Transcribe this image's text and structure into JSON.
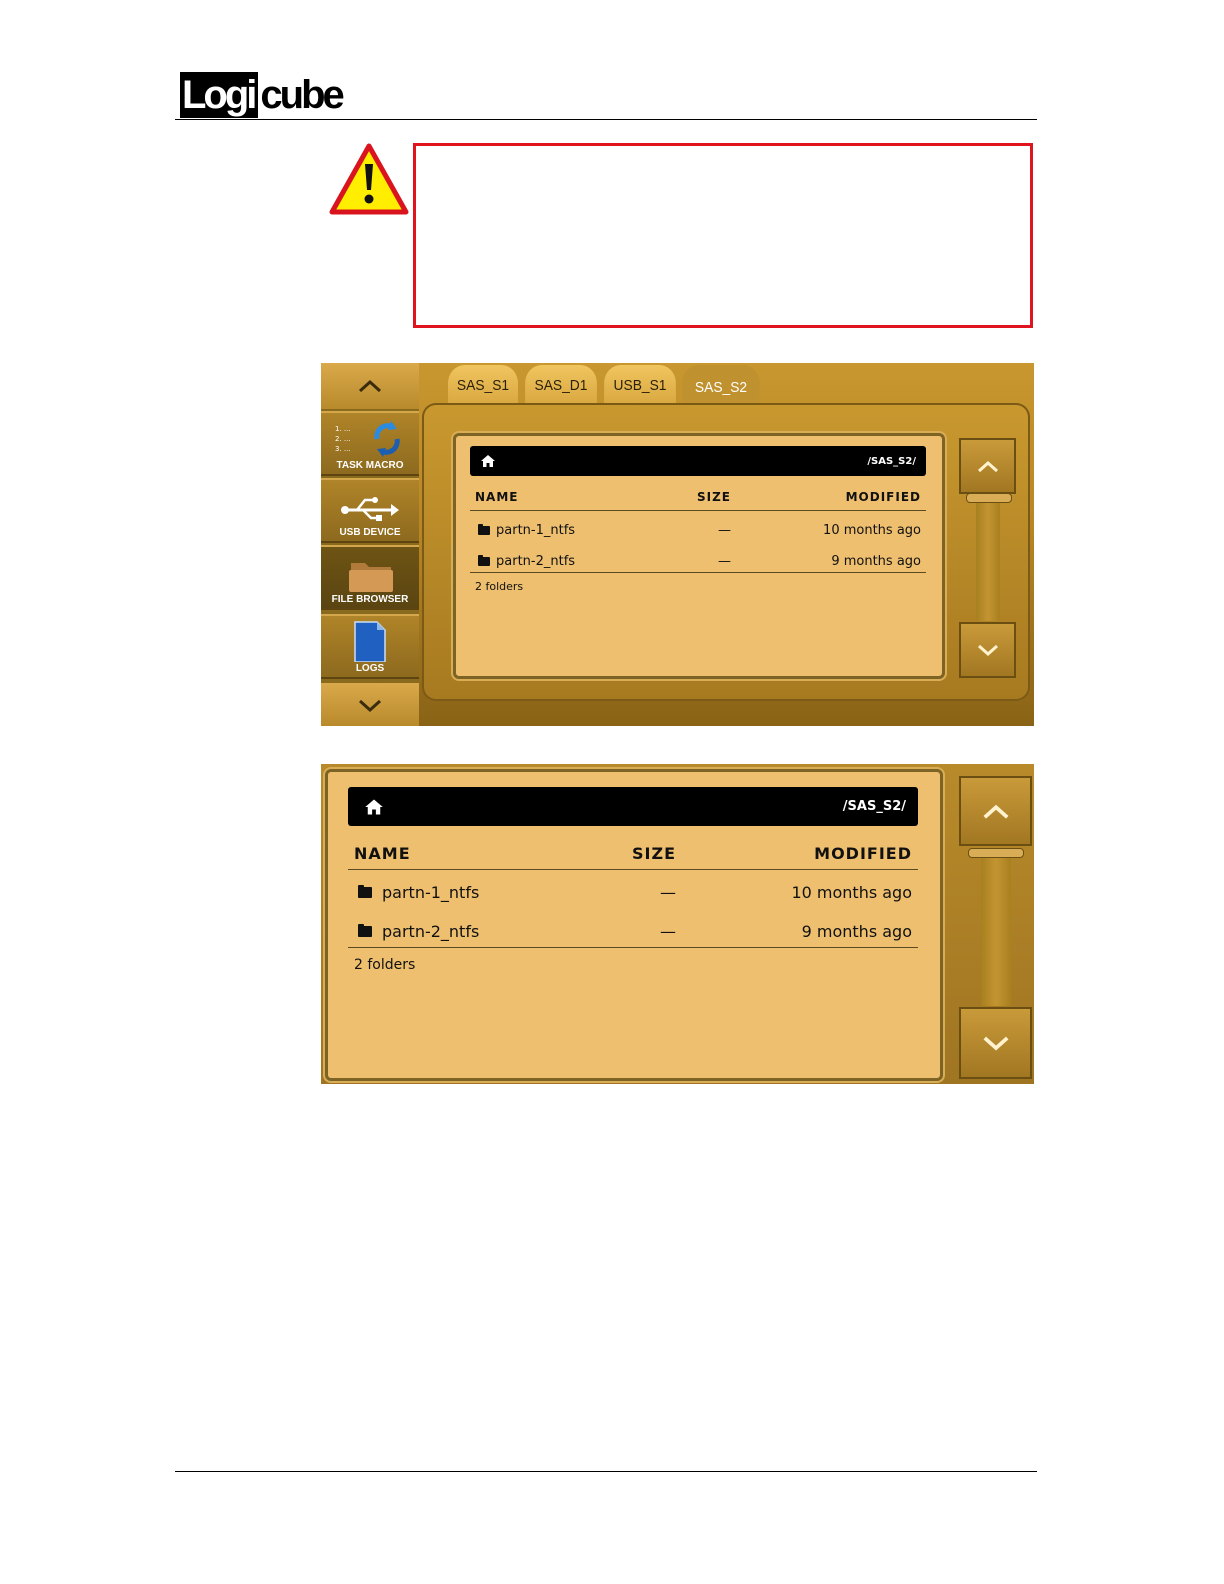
{
  "document": {
    "logo_black": "Logi",
    "logo_white": "cube"
  },
  "icons": {
    "warning": "warning-triangle-icon",
    "home": "home-icon",
    "folder": "folder-icon",
    "up": "chevron-up-icon",
    "down": "chevron-down-icon"
  },
  "colors": {
    "warning_border": "#e0141e",
    "panel_bg": "#eebf6f",
    "chrome_gold": "#c9972f",
    "pathbar_bg": "#000000"
  },
  "screen1": {
    "sidebar": {
      "items": [
        {
          "label": "TASK MACRO",
          "icon": "task-macro-icon",
          "active": false
        },
        {
          "label": "USB DEVICE",
          "icon": "usb-icon",
          "active": false
        },
        {
          "label": "FILE BROWSER",
          "icon": "folder-icon",
          "active": true
        },
        {
          "label": "LOGS",
          "icon": "document-icon",
          "active": false
        }
      ]
    },
    "tabs": [
      {
        "label": "SAS_S1",
        "active": false
      },
      {
        "label": "SAS_D1",
        "active": false
      },
      {
        "label": "USB_S1",
        "active": false
      },
      {
        "label": "SAS_S2",
        "active": true
      }
    ],
    "browser": {
      "path": "/SAS_S2/",
      "columns": {
        "name": "NAME",
        "size": "SIZE",
        "modified": "MODIFIED"
      },
      "rows": [
        {
          "name": "partn-1_ntfs",
          "size": "—",
          "modified": "10 months ago"
        },
        {
          "name": "partn-2_ntfs",
          "size": "—",
          "modified": "9 months ago"
        }
      ],
      "summary": "2 folders"
    }
  },
  "screen2": {
    "browser": {
      "path": "/SAS_S2/",
      "columns": {
        "name": "NAME",
        "size": "SIZE",
        "modified": "MODIFIED"
      },
      "rows": [
        {
          "name": "partn-1_ntfs",
          "size": "—",
          "modified": "10 months ago"
        },
        {
          "name": "partn-2_ntfs",
          "size": "—",
          "modified": "9 months ago"
        }
      ],
      "summary": "2 folders"
    }
  }
}
